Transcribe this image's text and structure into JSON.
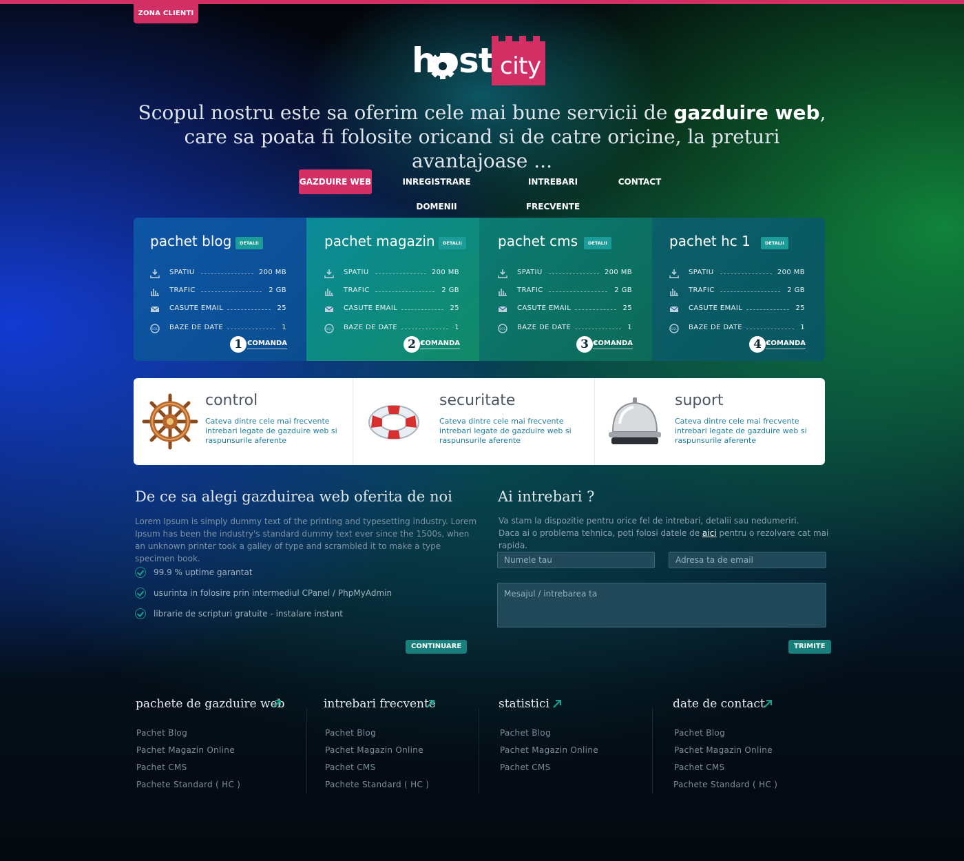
{
  "zona_clienti": "ZONA CLIENTI",
  "logo": {
    "host": "host",
    "city": "city"
  },
  "tagline": {
    "part1": "Scopul nostru este  sa oferim cele mai bune servicii de ",
    "bold": "gazduire web",
    "part2": ", care sa poata fi folosite oricand si de catre oricine, la preturi avantajoase ..."
  },
  "nav": [
    "GAZDUIRE WEB",
    "INREGISTRARE DOMENII",
    "INTREBARI FRECVENTE",
    "CONTACT"
  ],
  "colors": {
    "accent": "#d22f65",
    "teal": "#177f7c",
    "link_blue": "#1f7e9e"
  },
  "packages": [
    {
      "title": "pachet blog",
      "detalii": "DETALII",
      "spatiu": "200 MB",
      "trafic": "2 GB",
      "email": "25",
      "db": "1",
      "price": "1",
      "currency": "€",
      "cmd": "COMANDA"
    },
    {
      "title": "pachet magazin",
      "detalii": "DETALII",
      "spatiu": "200 MB",
      "trafic": "2 GB",
      "email": "25",
      "db": "1",
      "price": "2",
      "currency": "€",
      "cmd": "COMANDA"
    },
    {
      "title": "pachet cms",
      "detalii": "DETALII",
      "spatiu": "200 MB",
      "trafic": "2 GB",
      "email": "25",
      "db": "1",
      "price": "3",
      "currency": "€",
      "cmd": "COMANDA"
    },
    {
      "title": "pachet hc 1",
      "detalii": "DETALII",
      "spatiu": "200 MB",
      "trafic": "2 GB",
      "email": "25",
      "db": "1",
      "price": "4",
      "currency": "€",
      "cmd": "COMANDA"
    }
  ],
  "row_labels": {
    "spatiu": "SPATIU",
    "trafic": "TRAFIC",
    "email": "CASUTE EMAIL",
    "db": "BAZE DE DATE"
  },
  "features": [
    {
      "title": "control",
      "desc": "Cateva dintre cele mai frecvente intrebari legate de gazduire web si raspunsurile aferente",
      "icon": "ship-wheel-icon"
    },
    {
      "title": "securitate",
      "desc": "Cateva dintre cele mai frecvente intrebari legate de gazduire web si raspunsurile aferente",
      "icon": "lifebuoy-icon"
    },
    {
      "title": "suport",
      "desc": "Cateva dintre cele mai frecvente intrebari legate de gazduire web si raspunsurile aferente",
      "icon": "service-bell-icon"
    }
  ],
  "why": {
    "title": "De ce sa alegi gazduirea web oferita de noi",
    "text": "Lorem Ipsum is simply dummy text of the printing and typesetting industry. Lorem Ipsum has been the industry's standard dummy text ever since the 1500s, when an unknown printer took a galley of type and scrambled it to make a type specimen book.",
    "bullets": [
      "99.9 % uptime garantat",
      "usurinta in folosire prin intermediul CPanel / PhpMyAdmin",
      "librarie de scripturi gratuite - instalare instant"
    ],
    "button": "CONTINUARE"
  },
  "ask": {
    "title": "Ai intrebari ?",
    "line1": "Va stam la dispozitie pentru orice fel de intrebari, detalii sau nedumeriri.",
    "line2_pre": "Daca ai o problema tehnica, poti folosi datele de ",
    "link": "aici",
    "line2_post": " pentru o rezolvare cat mai rapida.",
    "name_placeholder": "Numele tau",
    "email_placeholder": "Adresa ta de email",
    "message_placeholder": "Mesajul / intrebarea ta",
    "button": "TRIMITE"
  },
  "footer": [
    {
      "title": "pachete de gazduire web",
      "links": [
        "Pachet Blog",
        "Pachet Magazin Online",
        "Pachet CMS",
        "Pachete Standard ( HC )"
      ]
    },
    {
      "title": "intrebari frecvente",
      "links": [
        "Pachet Blog",
        "Pachet Magazin Online",
        "Pachet CMS",
        "Pachete Standard ( HC )"
      ]
    },
    {
      "title": "statistici",
      "links": [
        "Pachet Blog",
        "Pachet Magazin Online",
        "Pachet CMS"
      ]
    },
    {
      "title": "date de contact",
      "links": [
        "Pachet Blog",
        "Pachet Magazin Online",
        "Pachet CMS",
        "Pachete Standard ( HC )"
      ]
    }
  ]
}
